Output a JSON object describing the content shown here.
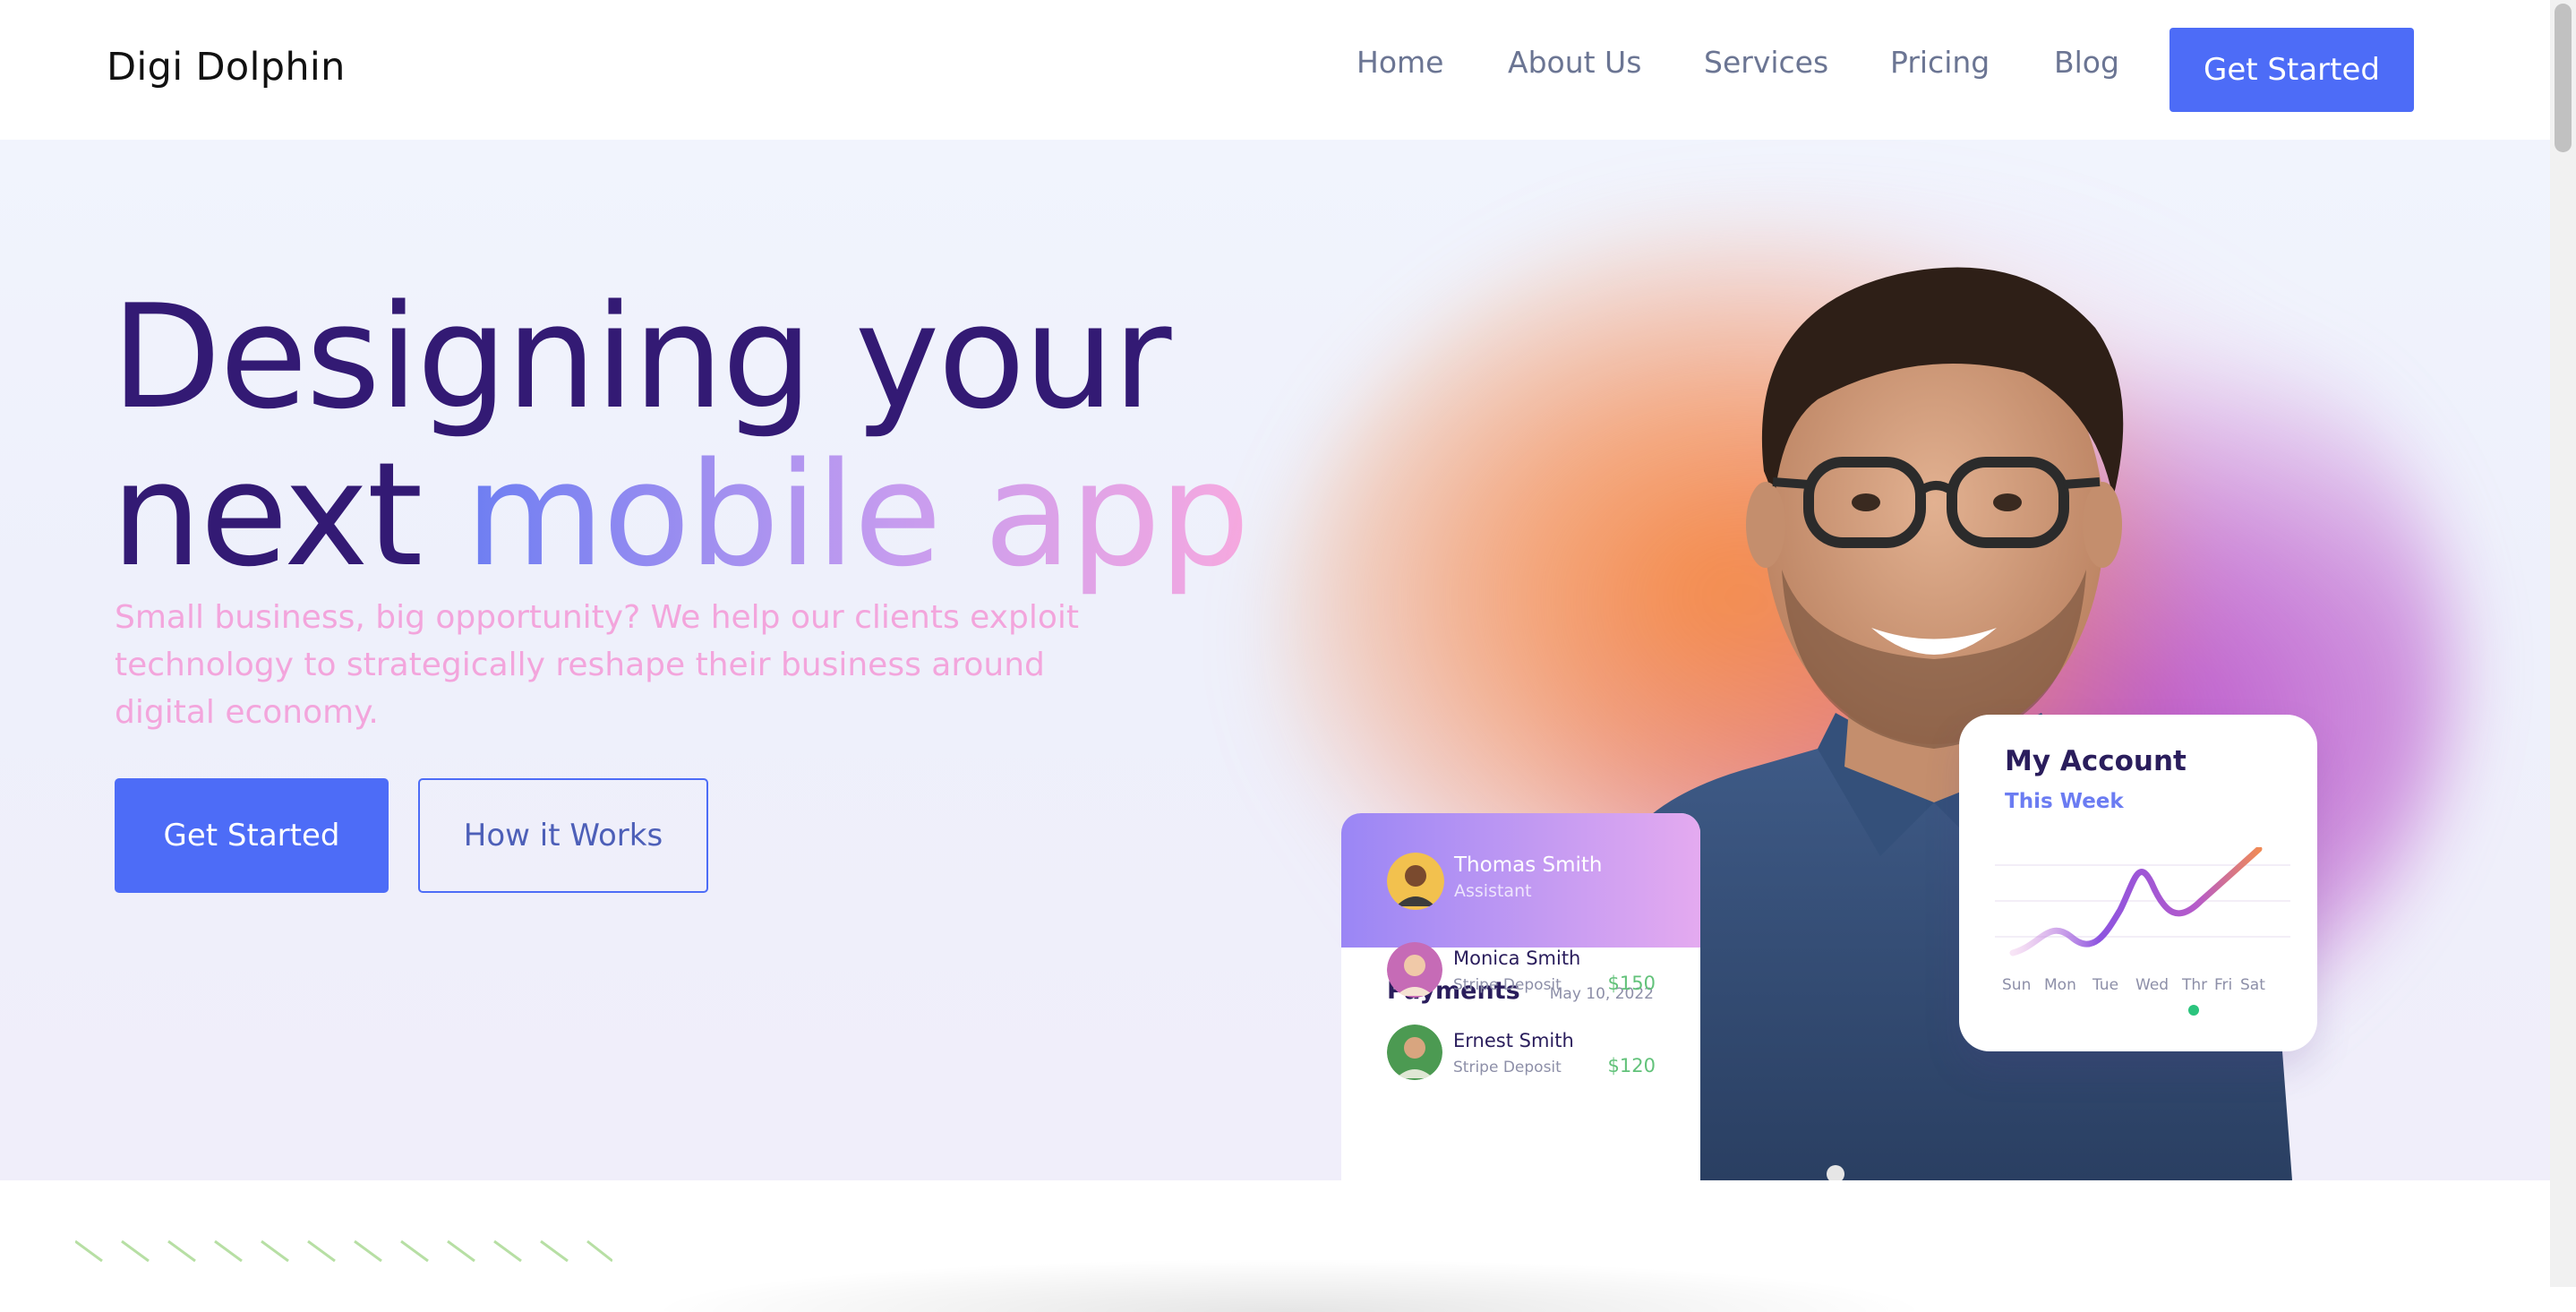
{
  "brand": {
    "logo": "Digi Dolphin"
  },
  "nav": {
    "items": [
      {
        "label": "Home"
      },
      {
        "label": "About Us"
      },
      {
        "label": "Services"
      },
      {
        "label": "Pricing"
      },
      {
        "label": "Blog"
      }
    ],
    "cta_label": "Get Started"
  },
  "hero": {
    "headline_line1": "Designing your",
    "headline_line2_plain": "next",
    "headline_line2_accent": "mobile app",
    "subtitle": "Small business, big opportunity? We help our clients exploit technology to strategically reshape their business around digital economy.",
    "primary_button": "Get Started",
    "secondary_button": "How it Works"
  },
  "payments_card": {
    "user_name": "Thomas Smith",
    "user_role": "Assistant",
    "title": "Payments",
    "date": "May 10, 2022",
    "rows": [
      {
        "name": "Monica Smith",
        "source": "Stripe Deposit",
        "amount": "$150"
      },
      {
        "name": "Ernest Smith",
        "source": "Stripe Deposit",
        "amount": "$120"
      }
    ]
  },
  "account_card": {
    "title": "My Account",
    "subtitle": "This Week",
    "days": [
      "Sun",
      "Mon",
      "Tue",
      "Wed",
      "Thr",
      "Fri",
      "Sat"
    ],
    "highlight_day": "Thr"
  },
  "colors": {
    "primary": "#4d6cf7",
    "headline": "#331a74",
    "subtitle": "#f3a5dc",
    "positive_amount": "#62c27a",
    "active_dot": "#2bc47d"
  }
}
